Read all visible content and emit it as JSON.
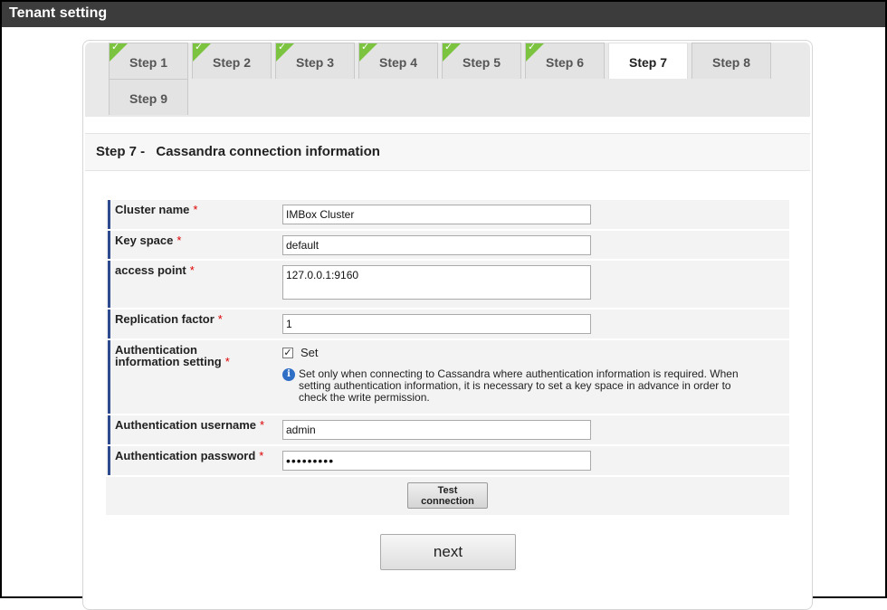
{
  "window": {
    "title": "Tenant setting"
  },
  "tabs": [
    {
      "label": "Step 1",
      "completed": true
    },
    {
      "label": "Step 2",
      "completed": true
    },
    {
      "label": "Step 3",
      "completed": true
    },
    {
      "label": "Step 4",
      "completed": true
    },
    {
      "label": "Step 5",
      "completed": true
    },
    {
      "label": "Step 6",
      "completed": true
    },
    {
      "label": "Step 7",
      "active": true
    },
    {
      "label": "Step 8"
    },
    {
      "label": "Step 9"
    }
  ],
  "section": {
    "step": "Step 7 -",
    "title": "Cassandra connection information"
  },
  "form": {
    "cluster_name": {
      "label": "Cluster name",
      "value": "IMBox Cluster"
    },
    "key_space": {
      "label": "Key space",
      "value": "default"
    },
    "access_point": {
      "label": "access point",
      "value": "127.0.0.1:9160"
    },
    "replication_factor": {
      "label": "Replication factor",
      "value": "1"
    },
    "auth_setting": {
      "label": "Authentication information setting",
      "checkbox_label": "Set",
      "checked": true,
      "info": "Set only when connecting to Cassandra where authentication information is required. When setting authentication information, it is necessary to set a key space in advance in order to check the write permission."
    },
    "auth_username": {
      "label": "Authentication username",
      "value": "admin"
    },
    "auth_password": {
      "label": "Authentication password",
      "value": "•••••••••"
    },
    "required_mark": "*",
    "test_button": "Test connection"
  },
  "next_button": "next",
  "colors": {
    "titlebar": "#3c3c3c",
    "check": "#7cc43f",
    "label_accent": "#2e4a8f",
    "required": "#dd0000",
    "info": "#2f6fc6"
  }
}
